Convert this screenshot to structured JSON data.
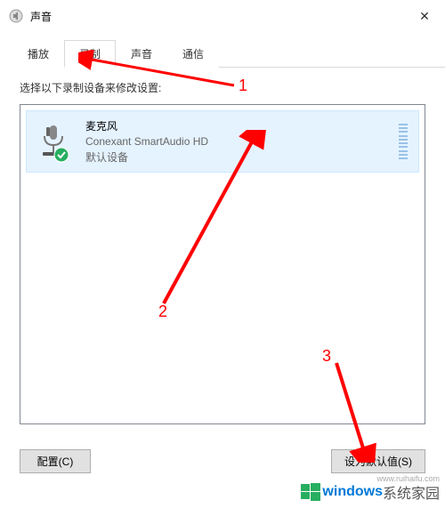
{
  "titlebar": {
    "title": "声音"
  },
  "tabs": {
    "items": [
      "播放",
      "录制",
      "声音",
      "通信"
    ],
    "active_index": 1
  },
  "content": {
    "instruction": "选择以下录制设备来修改设置:"
  },
  "device": {
    "name": "麦克风",
    "desc": "Conexant SmartAudio HD",
    "status": "默认设备"
  },
  "buttons": {
    "configure": "配置(C)",
    "set_default": "设为默认值(S)"
  },
  "annotations": {
    "n1": "1",
    "n2": "2",
    "n3": "3"
  },
  "watermark": {
    "brand1": "windows",
    "brand2": "系统家园",
    "url": "www.ruihaifu.com"
  }
}
